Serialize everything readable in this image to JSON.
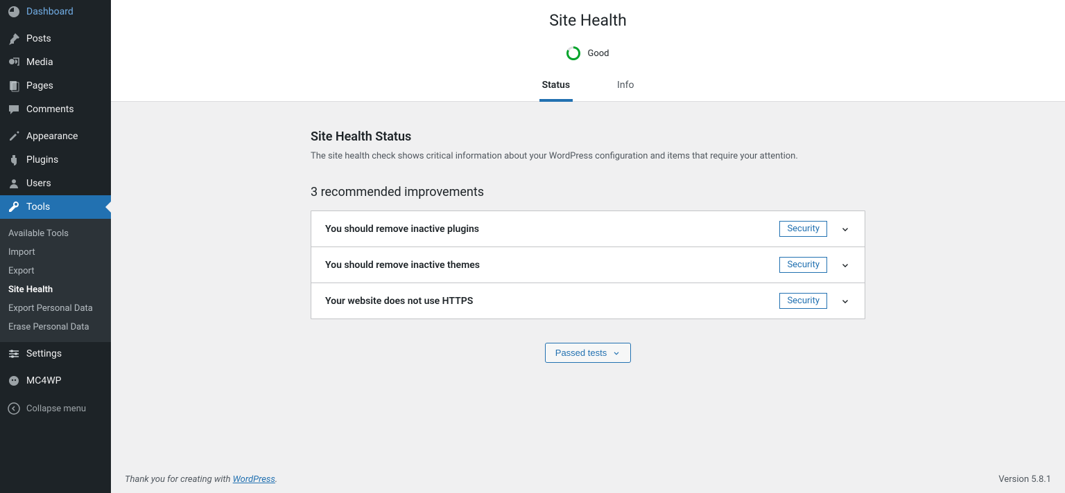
{
  "sidebar": {
    "items": [
      {
        "icon": "dashboard",
        "label": "Dashboard"
      },
      {
        "icon": "pin",
        "label": "Posts"
      },
      {
        "icon": "media",
        "label": "Media"
      },
      {
        "icon": "pages",
        "label": "Pages"
      },
      {
        "icon": "comments",
        "label": "Comments"
      }
    ],
    "items2": [
      {
        "icon": "appearance",
        "label": "Appearance"
      },
      {
        "icon": "plugins",
        "label": "Plugins"
      },
      {
        "icon": "users",
        "label": "Users"
      },
      {
        "icon": "tools",
        "label": "Tools",
        "current": true
      }
    ],
    "submenu": [
      {
        "label": "Available Tools"
      },
      {
        "label": "Import"
      },
      {
        "label": "Export"
      },
      {
        "label": "Site Health",
        "current": true
      },
      {
        "label": "Export Personal Data"
      },
      {
        "label": "Erase Personal Data"
      }
    ],
    "items3": [
      {
        "icon": "settings",
        "label": "Settings"
      }
    ],
    "items4": [
      {
        "icon": "mc4wp",
        "label": "MC4WP"
      }
    ],
    "collapse": "Collapse menu"
  },
  "header": {
    "title": "Site Health",
    "status_label": "Good",
    "tabs": [
      {
        "label": "Status",
        "active": true
      },
      {
        "label": "Info"
      }
    ]
  },
  "main": {
    "section_title": "Site Health Status",
    "section_desc": "The site health check shows critical information about your WordPress configuration and items that require your attention.",
    "improvements_title": "3 recommended improvements",
    "items": [
      {
        "title": "You should remove inactive plugins",
        "badge": "Security"
      },
      {
        "title": "You should remove inactive themes",
        "badge": "Security"
      },
      {
        "title": "Your website does not use HTTPS",
        "badge": "Security"
      }
    ],
    "passed_button": "Passed tests"
  },
  "footer": {
    "thanks_prefix": "Thank you for creating with ",
    "thanks_link": "WordPress",
    "thanks_suffix": ".",
    "version": "Version 5.8.1"
  }
}
